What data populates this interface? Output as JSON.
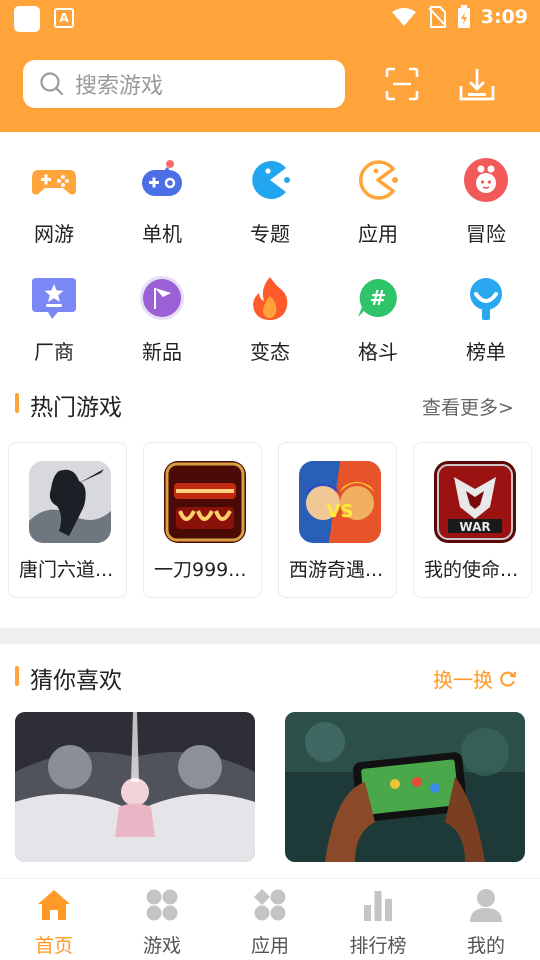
{
  "status_bar": {
    "time": "3:09"
  },
  "search": {
    "placeholder": "搜索游戏"
  },
  "categories": [
    {
      "label": "网游",
      "icon": "gamepad-icon",
      "color": "#ffa43a"
    },
    {
      "label": "单机",
      "icon": "joystick-icon",
      "color": "#4c6fe7"
    },
    {
      "label": "专题",
      "icon": "pacman-icon",
      "color": "#22a6f0"
    },
    {
      "label": "应用",
      "icon": "pacman-outline-icon",
      "color": "#ffa43a"
    },
    {
      "label": "冒险",
      "icon": "character-icon",
      "color": "#f25a5a"
    },
    {
      "label": "厂商",
      "icon": "star-badge-icon",
      "color": "#7b87f5"
    },
    {
      "label": "新品",
      "icon": "flag-icon",
      "color": "#9b5fd6"
    },
    {
      "label": "变态",
      "icon": "flame-icon",
      "color": "#ff5a2a"
    },
    {
      "label": "格斗",
      "icon": "hashtag-chat-icon",
      "color": "#2fc36a"
    },
    {
      "label": "榜单",
      "icon": "headset-icon",
      "color": "#2aa8ef"
    }
  ],
  "hot_games": {
    "title": "热门游戏",
    "more": "查看更多>",
    "items": [
      {
        "name": "唐门六道..."
      },
      {
        "name": "一刀999..."
      },
      {
        "name": "西游奇遇..."
      },
      {
        "name": "我的使命..."
      }
    ]
  },
  "recommend": {
    "title": "猜你喜欢",
    "refresh": "换一换"
  },
  "bottom_nav": [
    {
      "label": "首页",
      "active": true
    },
    {
      "label": "游戏",
      "active": false
    },
    {
      "label": "应用",
      "active": false
    },
    {
      "label": "排行榜",
      "active": false
    },
    {
      "label": "我的",
      "active": false
    }
  ],
  "colors": {
    "accent": "#ffa43a",
    "active_tab": "#ff9a2a"
  }
}
